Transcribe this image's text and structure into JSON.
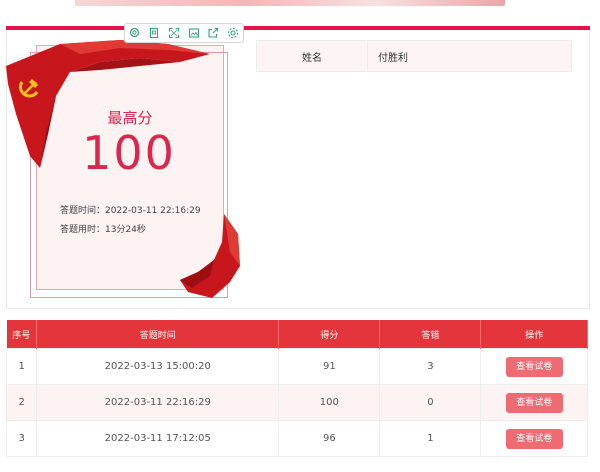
{
  "toolbar": {
    "icons": [
      "zoom-icon",
      "document-icon",
      "expand-icon",
      "image-icon",
      "share-icon",
      "settings-icon"
    ]
  },
  "profile": {
    "best_label": "最高分",
    "best_score": "100",
    "answer_time": "答题时间：2022-03-11 22:16:29",
    "duration": "答题用时：13分24秒"
  },
  "name_row": {
    "label": "姓名",
    "value": "付胜利"
  },
  "records": {
    "headers": [
      "序号",
      "答题时间",
      "得分",
      "答错",
      "操作"
    ],
    "rows": [
      {
        "no": "1",
        "time": "2022-03-13 15:00:20",
        "score": "91",
        "wrong": "3",
        "action": "查看试卷"
      },
      {
        "no": "2",
        "time": "2022-03-11 22:16:29",
        "score": "100",
        "wrong": "0",
        "action": "查看试卷"
      },
      {
        "no": "3",
        "time": "2022-03-11 17:12:05",
        "score": "96",
        "wrong": "1",
        "action": "查看试卷"
      }
    ]
  },
  "colors": {
    "accent": "#e5124a",
    "header_red": "#e5353c",
    "button": "#ee6b73",
    "score_text": "#d9274d"
  }
}
